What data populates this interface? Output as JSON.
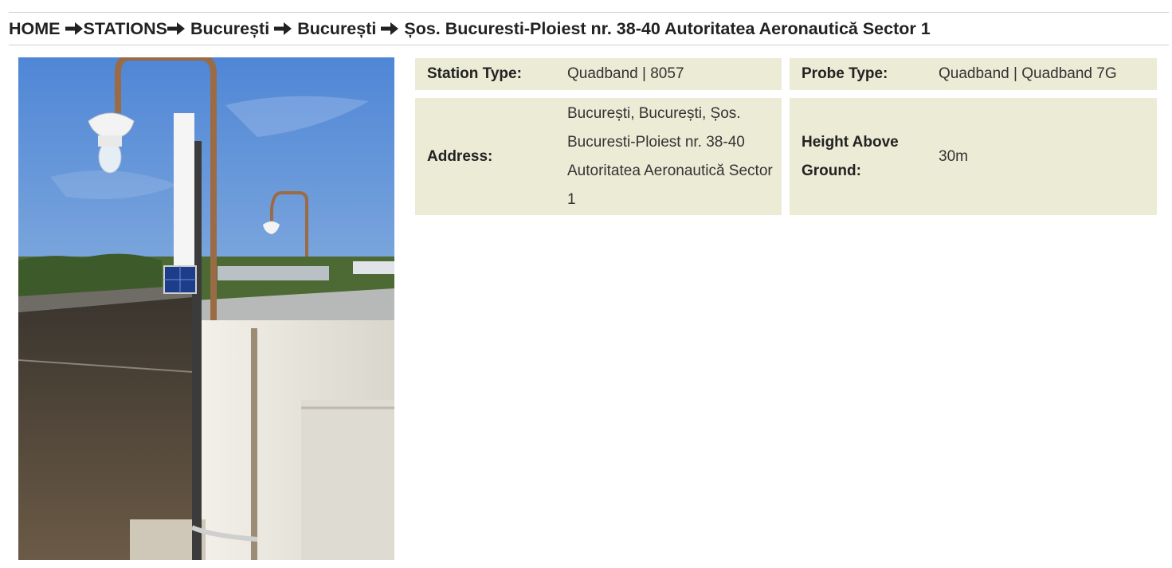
{
  "breadcrumb": {
    "items": [
      "HOME",
      "STATIONS",
      "București",
      "București",
      "Șos. Bucuresti-Ploiest nr. 38-40 Autoritatea Aeronautică Sector 1"
    ]
  },
  "details": {
    "station_type": {
      "label": "Station Type:",
      "value": "Quadband | 8057"
    },
    "probe_type": {
      "label": "Probe Type:",
      "value": "Quadband | Quadband 7G"
    },
    "address": {
      "label": "Address:",
      "value": "București, București, Șos. Bucuresti-Ploiest nr. 38-40 Autoritatea Aeronautică Sector 1"
    },
    "height": {
      "label": "Height Above Ground:",
      "value": "30m"
    }
  },
  "colors": {
    "panel_bg": "#ebebd6",
    "text": "#333333",
    "divider": "#d0d0d0"
  },
  "icons": {
    "separator": "arrow-right-icon"
  }
}
